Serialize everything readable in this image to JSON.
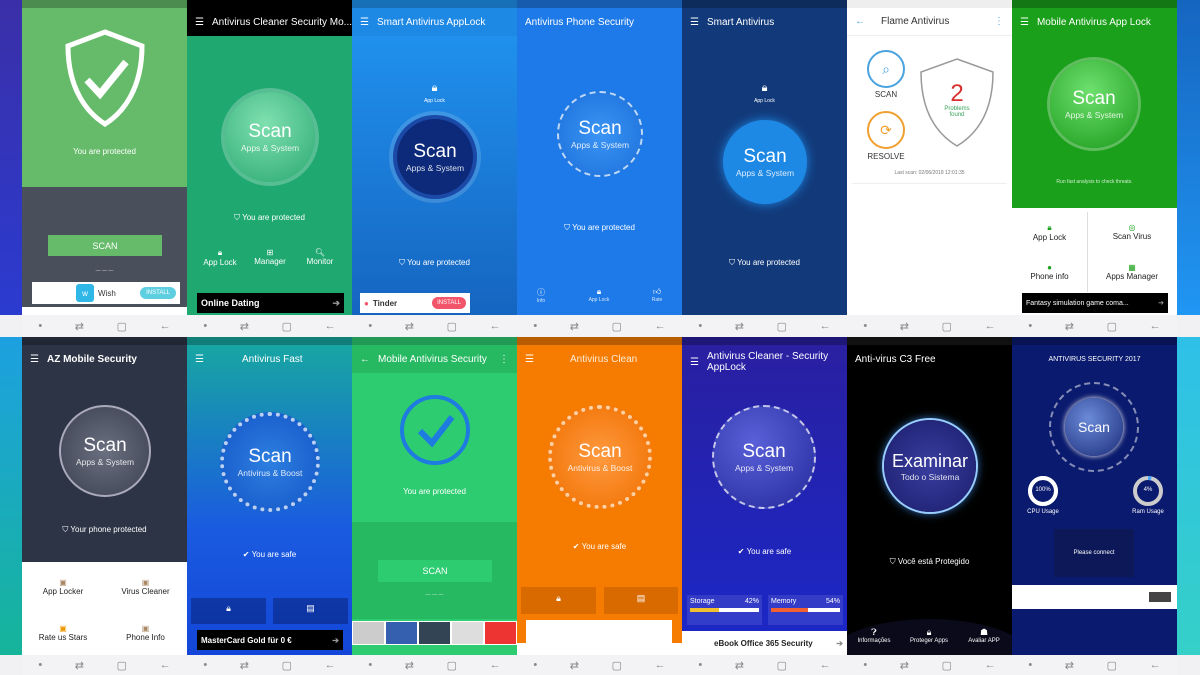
{
  "top": [
    {
      "protected": "You are protected",
      "scan": "SCAN",
      "ad_title": "Wish",
      "ad_button": "INSTALL"
    },
    {
      "title": "Antivirus Cleaner Security Mo...",
      "orb_main": "Scan",
      "orb_sub": "Apps & System",
      "protected": "You are protected",
      "actions": [
        "App Lock",
        "Manager",
        "Monitor"
      ],
      "ad_title": "Online Dating"
    },
    {
      "title": "Smart Antivirus AppLock",
      "applock": "App Lock",
      "orb_main": "Scan",
      "orb_sub": "Apps & System",
      "protected": "You are protected",
      "ad_title": "Tinder",
      "ad_button": "INSTALL"
    },
    {
      "title": "Antivirus Phone Security",
      "orb_main": "Scan",
      "orb_sub": "Apps & System",
      "protected": "You are protected",
      "nav": [
        "Info",
        "App Lock",
        "Rate"
      ]
    },
    {
      "title": "Smart Antivirus",
      "applock": "App Lock",
      "orb_main": "Scan",
      "orb_sub": "Apps & System",
      "protected": "You are protected"
    },
    {
      "title": "Flame Antivirus",
      "scan": "SCAN",
      "resolve": "RESOLVE",
      "problems_count": "2",
      "problems_label": "Problems found",
      "last_scan": "Last scan: 02/06/2018 12:01:35"
    },
    {
      "title": "Mobile Antivirus App Lock",
      "orb_main": "Scan",
      "orb_sub": "Apps & System",
      "hint": "Run fast analysis to check threats.",
      "grid": [
        "App Lock",
        "Scan Virus",
        "Phone info",
        "Apps Manager"
      ],
      "ad_title": "Fantasy simulation game coma..."
    }
  ],
  "bottom": [
    {
      "title": "AZ Mobile Security",
      "orb_main": "Scan",
      "orb_sub": "Apps & System",
      "protected": "Your phone protected",
      "grid": [
        "App Locker",
        "Virus Cleaner",
        "Rate us Stars",
        "Phone Info"
      ]
    },
    {
      "title": "Antivirus Fast",
      "orb_main": "Scan",
      "orb_sub": "Antivirus & Boost",
      "safe": "You are safe",
      "ad_title": "MasterCard Gold für 0 €"
    },
    {
      "title": "Mobile Antivirus Security",
      "protected": "You are protected",
      "scan": "SCAN"
    },
    {
      "title": "Antivirus Clean",
      "orb_main": "Scan",
      "orb_sub": "Antivirus & Boost",
      "safe": "You are safe"
    },
    {
      "title": "Antivirus Cleaner - Security AppLock",
      "orb_main": "Scan",
      "orb_sub": "Apps & System",
      "safe": "You are safe",
      "storage_label": "Storage",
      "storage_value": "42%",
      "memory_label": "Memory",
      "memory_value": "54%",
      "storage_fraction": 0.42,
      "memory_fraction": 0.54,
      "ad_title": "eBook Office 365 Security"
    },
    {
      "title": "Anti-virus C3 Free",
      "orb_main": "Examinar",
      "orb_sub": "Todo o Sistema",
      "protected": "Você está Protegido",
      "nav": [
        "Informações",
        "Proteger Apps",
        "Avaliar APP"
      ]
    },
    {
      "title": "ANTIVIRUS SECURITY 2017",
      "orb_main": "Scan",
      "cpu_value": "100%",
      "cpu_label": "CPU Usage",
      "ram_value": "4%",
      "ram_label": "Ram Usage",
      "connect": "Please connect",
      "cpu_fraction": 1.0,
      "ram_fraction": 0.04
    }
  ],
  "navbar": {
    "recent": "⇄",
    "home": "▢",
    "back": "←",
    "dot": "•"
  }
}
